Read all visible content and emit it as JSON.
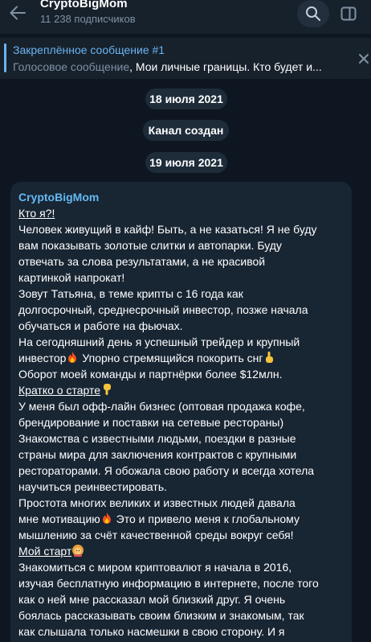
{
  "header": {
    "title": "CryptoBigMom",
    "subscribers": "11 238 подписчиков",
    "icons": {
      "back": "arrow-left-icon",
      "search": "search-icon",
      "panel": "sidebar-panel-icon"
    }
  },
  "pinned": {
    "title": "Закреплённое сообщение #1",
    "prefix": "Голосовое сообщение",
    "text": ", Мои личные границы. Кто будет и..."
  },
  "dates": {
    "first": "18 июля 2021",
    "service": "Канал создан",
    "second": "19 июля 2021"
  },
  "message": {
    "author": "CryptoBigMom",
    "lines": [
      {
        "text": "Кто я?!",
        "underline": true
      },
      {
        "text": "Человек живущий в кайф! Быть, а не казаться! Я не буду"
      },
      {
        "text": "вам показывать золотые слитки и автопарки. Буду"
      },
      {
        "text": "отвечать за слова результатами, а не красивой"
      },
      {
        "text": "картинкой напрокат!"
      },
      {
        "text": "Зовут Татьяна, в теме крипты с 16 года как"
      },
      {
        "text": "долгосрочный, среднесрочный инвестор, позже начала"
      },
      {
        "text": "обучаться и работе на фьючах."
      },
      {
        "text": "На сегодняшний день я успешный трейдер и крупный"
      },
      {
        "text": "инвестор",
        "emoji": "fire",
        "after": " Упорно стремящийся покорить снг",
        "emoji2": "point-up"
      },
      {
        "text": "Оборот моей команды и партнёрки более $12млн."
      },
      {
        "text": "Кратко о старте",
        "underline": true,
        "emoji": "point-down"
      },
      {
        "text": "У меня был офф-лайн бизнес (оптовая продажа кофе,"
      },
      {
        "text": "брендирование и поставки на сетевые рестораны)"
      },
      {
        "text": "Знакомства с известными людьми,  поездки в разные"
      },
      {
        "text": "страны мира для заключения контрактов с крупными"
      },
      {
        "text": "рестораторами. Я обожала свою работу и всегда хотела"
      },
      {
        "text": "научиться реинвестировать."
      },
      {
        "text": "Простота многих великих и известных людей давала"
      },
      {
        "text": "мне мотивацию",
        "emoji": "fire",
        "after": " Это и привело меня к глобальному"
      },
      {
        "text": "мышлению за счёт качественной среды вокруг себя!"
      },
      {
        "text": "Мой старт",
        "underline": true,
        "emoji": "woman-emoji"
      },
      {
        "text": "Знакомиться с миром криптовалют я начала в 2016,"
      },
      {
        "text": "изучая бесплатную информацию в интернете, после того"
      },
      {
        "text": "как о ней мне рассказал мой близкий друг. Я очень"
      },
      {
        "text": "боялась рассказывать своим близким и знакомым, так"
      },
      {
        "text": "как слышала только насмешки в свою сторону. И я"
      }
    ]
  }
}
